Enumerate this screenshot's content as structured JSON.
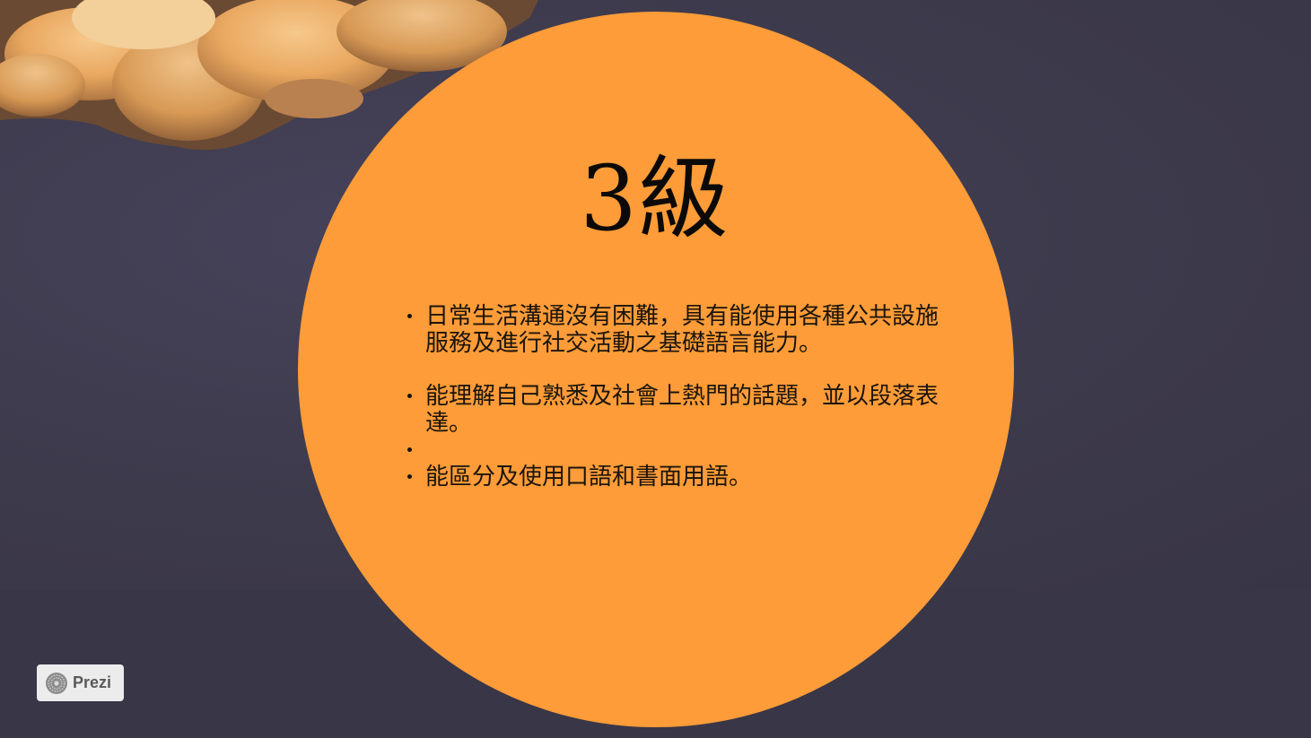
{
  "slide": {
    "title": "3級",
    "bullets": [
      "日常生活溝通沒有困難，具有能使用各種公共設施服務及進行社交活動之基礎語言能力。",
      "能理解自己熟悉及社會上熱門的話題，並以段落表達。",
      "",
      "能區分及使用口語和書面用語。"
    ]
  },
  "branding": {
    "logo_icon": "prezi-logo-icon",
    "label": "Prezi"
  },
  "colors": {
    "background": "#3b3749",
    "circle": "#fd9c38",
    "text": "#1a140c"
  }
}
